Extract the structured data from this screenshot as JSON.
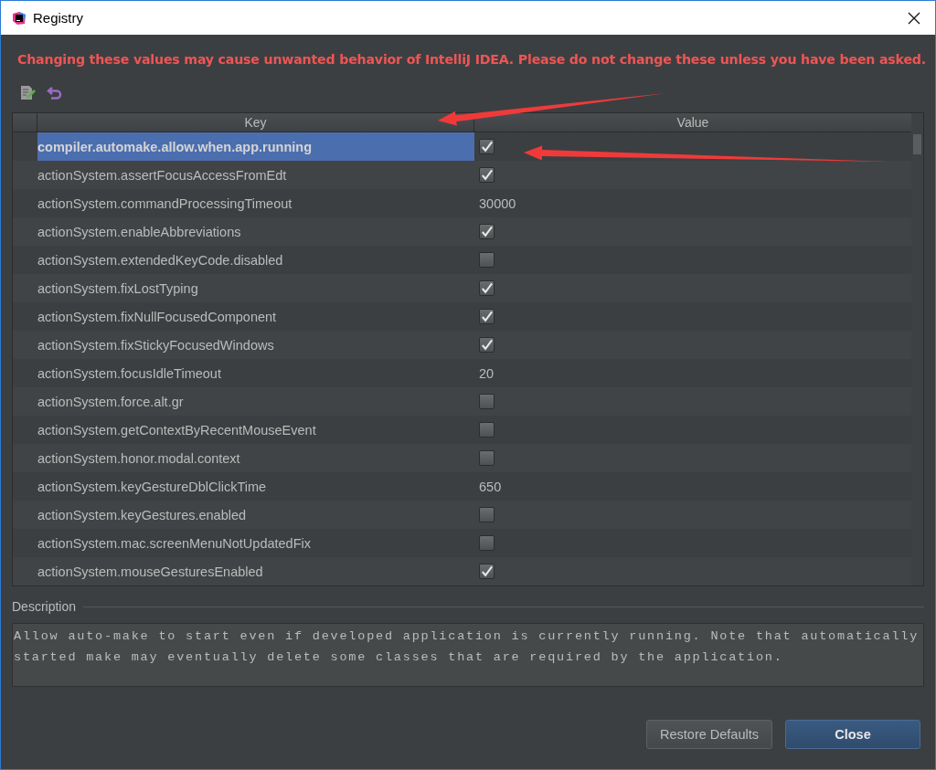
{
  "window": {
    "title": "Registry"
  },
  "warning": "Changing these values may cause unwanted behavior of IntelliJ IDEA. Please do not change these unless you have been asked.",
  "table": {
    "columns": [
      "Key",
      "Value"
    ],
    "rows": [
      {
        "key": "compiler.automake.allow.when.app.running",
        "kind": "checkbox",
        "checked": true,
        "selected": true
      },
      {
        "key": "actionSystem.assertFocusAccessFromEdt",
        "kind": "checkbox",
        "checked": true,
        "selected": false
      },
      {
        "key": "actionSystem.commandProcessingTimeout",
        "kind": "text",
        "value": "30000",
        "selected": false
      },
      {
        "key": "actionSystem.enableAbbreviations",
        "kind": "checkbox",
        "checked": true,
        "selected": false
      },
      {
        "key": "actionSystem.extendedKeyCode.disabled",
        "kind": "checkbox",
        "checked": false,
        "selected": false
      },
      {
        "key": "actionSystem.fixLostTyping",
        "kind": "checkbox",
        "checked": true,
        "selected": false
      },
      {
        "key": "actionSystem.fixNullFocusedComponent",
        "kind": "checkbox",
        "checked": true,
        "selected": false
      },
      {
        "key": "actionSystem.fixStickyFocusedWindows",
        "kind": "checkbox",
        "checked": true,
        "selected": false
      },
      {
        "key": "actionSystem.focusIdleTimeout",
        "kind": "text",
        "value": "20",
        "selected": false
      },
      {
        "key": "actionSystem.force.alt.gr",
        "kind": "checkbox",
        "checked": false,
        "selected": false
      },
      {
        "key": "actionSystem.getContextByRecentMouseEvent",
        "kind": "checkbox",
        "checked": false,
        "selected": false
      },
      {
        "key": "actionSystem.honor.modal.context",
        "kind": "checkbox",
        "checked": false,
        "selected": false
      },
      {
        "key": "actionSystem.keyGestureDblClickTime",
        "kind": "text",
        "value": "650",
        "selected": false
      },
      {
        "key": "actionSystem.keyGestures.enabled",
        "kind": "checkbox",
        "checked": false,
        "selected": false
      },
      {
        "key": "actionSystem.mac.screenMenuNotUpdatedFix",
        "kind": "checkbox",
        "checked": false,
        "selected": false
      },
      {
        "key": "actionSystem.mouseGesturesEnabled",
        "kind": "checkbox",
        "checked": true,
        "selected": false
      }
    ]
  },
  "description": {
    "title": "Description",
    "text": "Allow auto-make to start even if developed application is currently running. Note that automatically started make may eventually delete some classes that are required by the application."
  },
  "buttons": [
    {
      "label": "Restore Defaults",
      "kind": "secondary"
    },
    {
      "label": "Close",
      "kind": "primary"
    }
  ],
  "annotations": [
    {
      "kind": "arrow"
    },
    {
      "kind": "arrow"
    }
  ]
}
